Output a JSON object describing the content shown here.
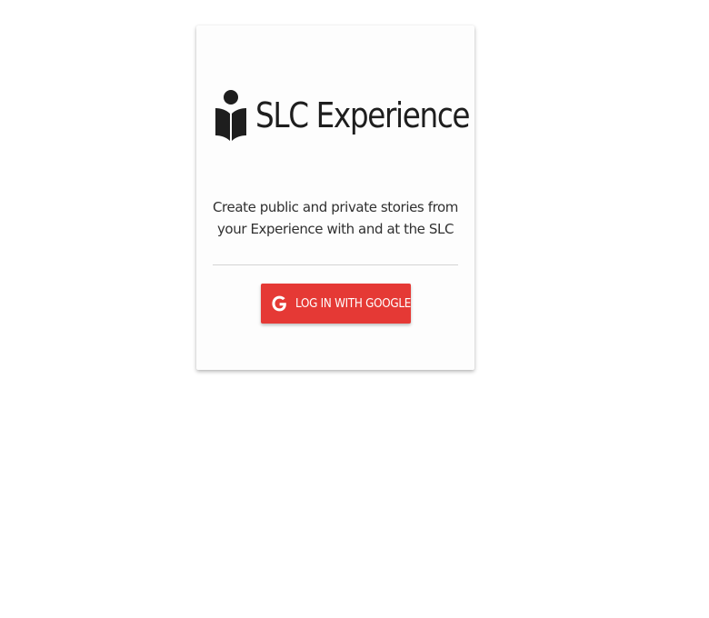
{
  "app": {
    "title": "SLC Experience",
    "logo_icon": "reader-book-icon"
  },
  "login_card": {
    "tagline": "Create public and private stories from your Experience with and at the SLC",
    "google_button": {
      "label": "LOG IN WITH GOOGLE",
      "icon": "google-icon"
    }
  },
  "colors": {
    "button_red": "#e53935",
    "text_dark": "#1e1e1e"
  }
}
